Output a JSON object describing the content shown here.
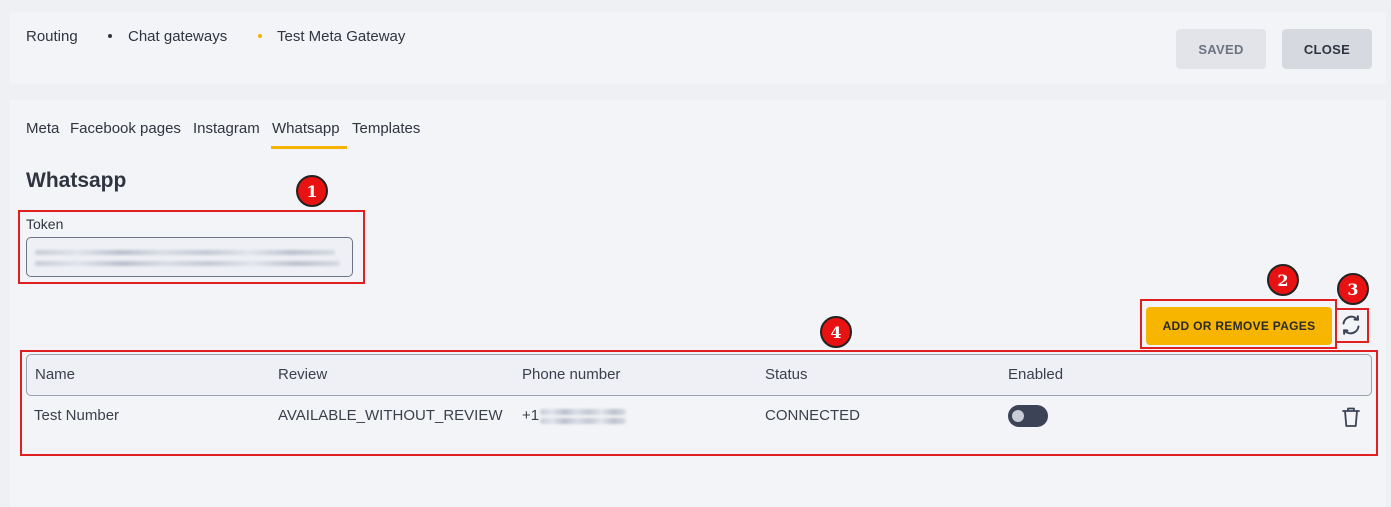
{
  "breadcrumb": {
    "items": [
      "Routing",
      "Chat gateways",
      "Test Meta Gateway"
    ]
  },
  "header_buttons": {
    "saved_label": "SAVED",
    "close_label": "CLOSE"
  },
  "tabs": [
    {
      "label": "Meta"
    },
    {
      "label": "Facebook pages"
    },
    {
      "label": "Instagram"
    },
    {
      "label": "Whatsapp",
      "active": true
    },
    {
      "label": "Templates"
    }
  ],
  "section": {
    "title": "Whatsapp",
    "token_label": "Token"
  },
  "actions": {
    "add_remove_label": "ADD OR REMOVE PAGES",
    "refresh_icon": "refresh-icon"
  },
  "table": {
    "headers": [
      "Name",
      "Review",
      "Phone number",
      "Status",
      "Enabled"
    ],
    "rows": [
      {
        "name": "Test Number",
        "review": "AVAILABLE_WITHOUT_REVIEW",
        "phone_prefix": "+1",
        "status": "CONNECTED",
        "enabled": false
      }
    ]
  },
  "annotations": [
    "1",
    "2",
    "3",
    "4"
  ],
  "colors": {
    "accent": "#f5b300",
    "annotation": "#e81212",
    "toggle_off": "#3d4357"
  }
}
